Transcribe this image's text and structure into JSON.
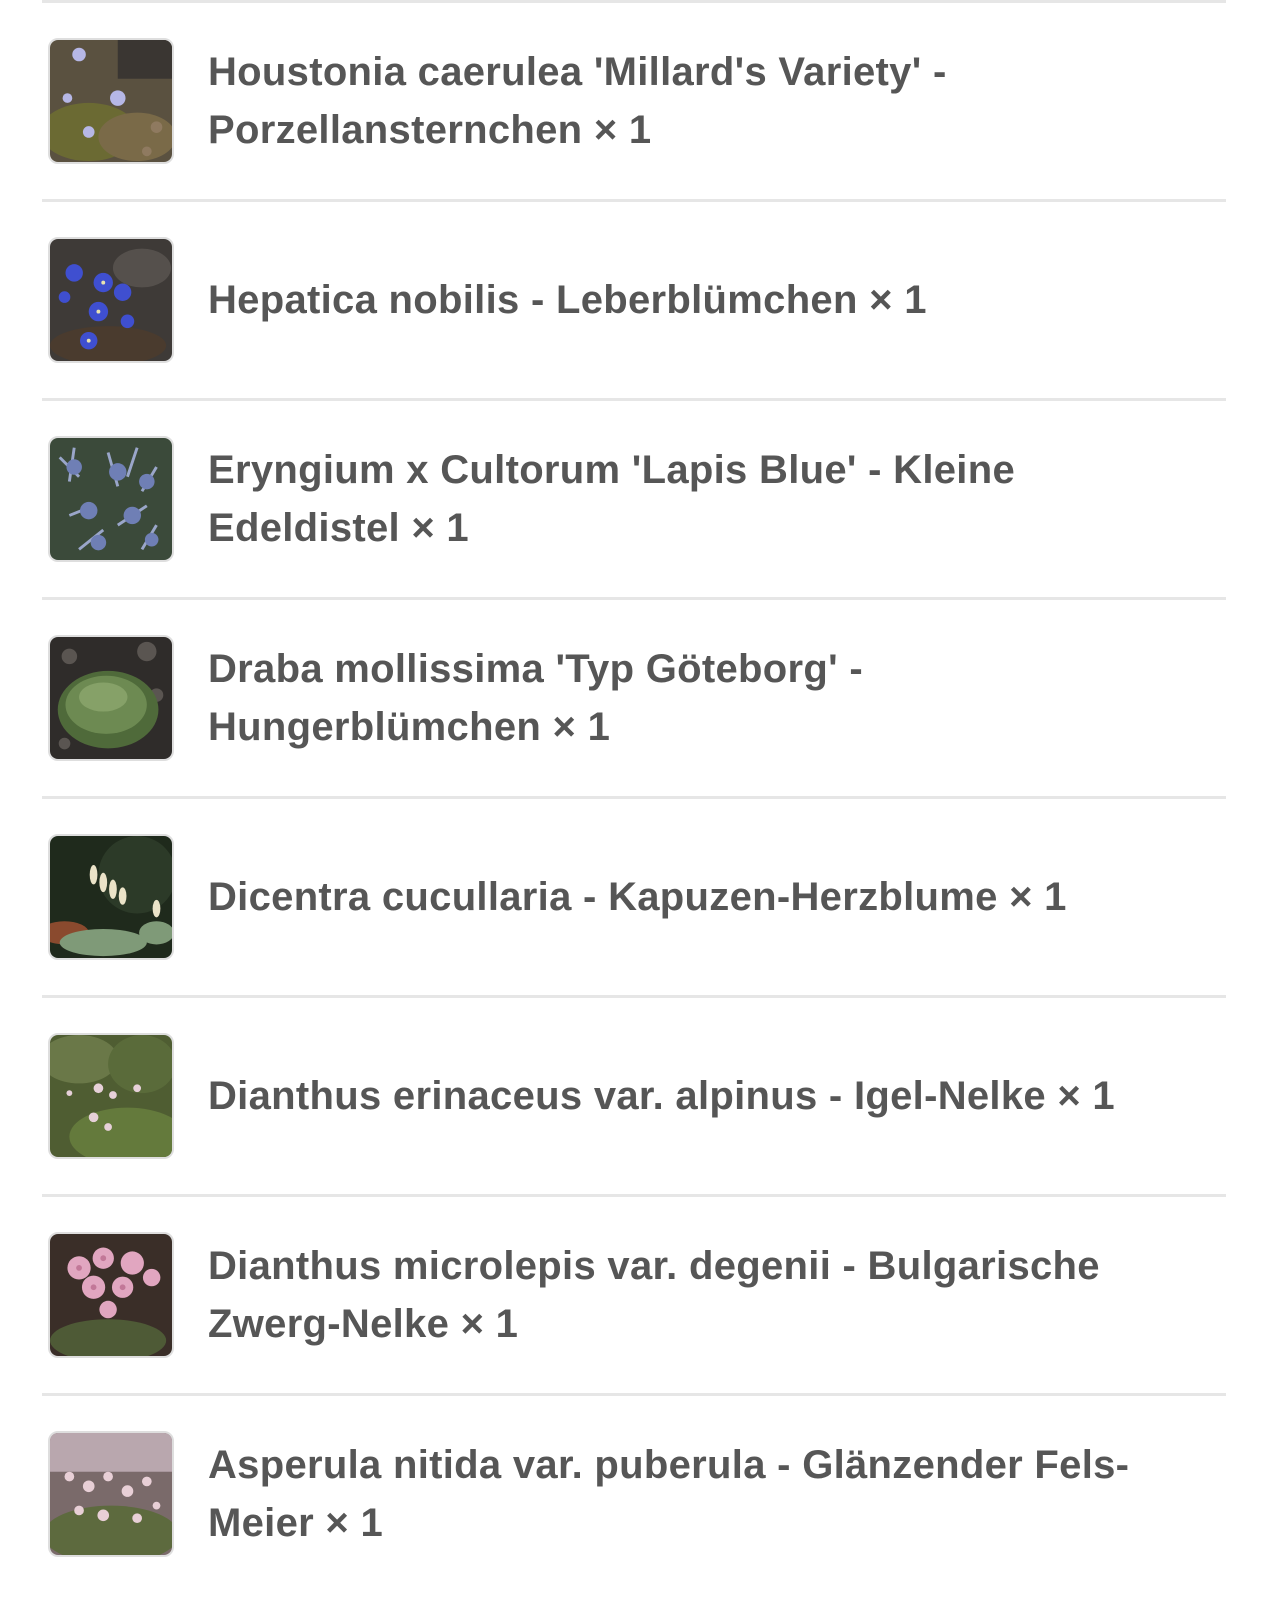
{
  "items": [
    {
      "label": "Houstonia caerulea 'Millard's Variety' - Porzellansternchen × 1",
      "thumbnail": "houstonia-flower-photo"
    },
    {
      "label": "Hepatica nobilis - Leberblümchen × 1",
      "thumbnail": "hepatica-flower-photo"
    },
    {
      "label": "Eryngium x Cultorum 'Lapis Blue' - Kleine Edeldistel × 1",
      "thumbnail": "eryngium-flower-photo"
    },
    {
      "label": "Draba mollissima 'Typ Göteborg' - Hungerblümchen × 1",
      "thumbnail": "draba-cushion-photo"
    },
    {
      "label": "Dicentra cucullaria - Kapuzen-Herzblume × 1",
      "thumbnail": "dicentra-flower-photo"
    },
    {
      "label": "Dianthus erinaceus var. alpinus - Igel-Nelke × 1",
      "thumbnail": "dianthus-erinaceus-photo"
    },
    {
      "label": "Dianthus microlepis var. degenii - Bulgarische Zwerg-Nelke × 1",
      "thumbnail": "dianthus-microlepis-photo"
    },
    {
      "label": "Asperula nitida var. puberula - Glänzender Fels-Meier × 1",
      "thumbnail": "asperula-flower-photo"
    }
  ],
  "colors": {
    "text": "#565656",
    "divider": "#e6e6e6",
    "thumb_border": "#dedede"
  }
}
